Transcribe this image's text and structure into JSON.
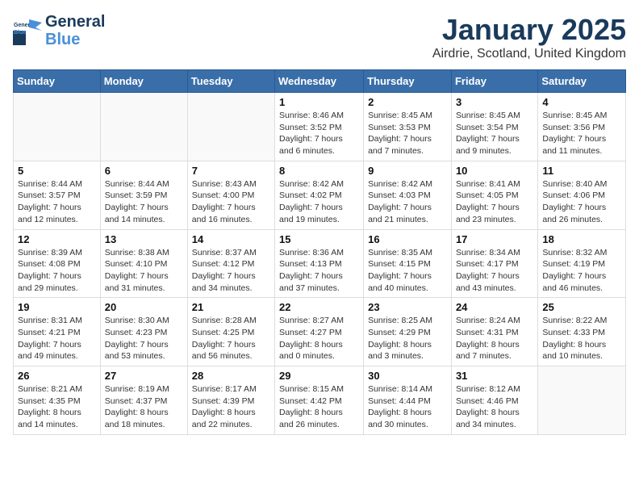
{
  "header": {
    "logo_general": "General",
    "logo_blue": "Blue",
    "month": "January 2025",
    "location": "Airdrie, Scotland, United Kingdom"
  },
  "weekdays": [
    "Sunday",
    "Monday",
    "Tuesday",
    "Wednesday",
    "Thursday",
    "Friday",
    "Saturday"
  ],
  "weeks": [
    [
      {
        "day": "",
        "info": ""
      },
      {
        "day": "",
        "info": ""
      },
      {
        "day": "",
        "info": ""
      },
      {
        "day": "1",
        "info": "Sunrise: 8:46 AM\nSunset: 3:52 PM\nDaylight: 7 hours and 6 minutes."
      },
      {
        "day": "2",
        "info": "Sunrise: 8:45 AM\nSunset: 3:53 PM\nDaylight: 7 hours and 7 minutes."
      },
      {
        "day": "3",
        "info": "Sunrise: 8:45 AM\nSunset: 3:54 PM\nDaylight: 7 hours and 9 minutes."
      },
      {
        "day": "4",
        "info": "Sunrise: 8:45 AM\nSunset: 3:56 PM\nDaylight: 7 hours and 11 minutes."
      }
    ],
    [
      {
        "day": "5",
        "info": "Sunrise: 8:44 AM\nSunset: 3:57 PM\nDaylight: 7 hours and 12 minutes."
      },
      {
        "day": "6",
        "info": "Sunrise: 8:44 AM\nSunset: 3:59 PM\nDaylight: 7 hours and 14 minutes."
      },
      {
        "day": "7",
        "info": "Sunrise: 8:43 AM\nSunset: 4:00 PM\nDaylight: 7 hours and 16 minutes."
      },
      {
        "day": "8",
        "info": "Sunrise: 8:42 AM\nSunset: 4:02 PM\nDaylight: 7 hours and 19 minutes."
      },
      {
        "day": "9",
        "info": "Sunrise: 8:42 AM\nSunset: 4:03 PM\nDaylight: 7 hours and 21 minutes."
      },
      {
        "day": "10",
        "info": "Sunrise: 8:41 AM\nSunset: 4:05 PM\nDaylight: 7 hours and 23 minutes."
      },
      {
        "day": "11",
        "info": "Sunrise: 8:40 AM\nSunset: 4:06 PM\nDaylight: 7 hours and 26 minutes."
      }
    ],
    [
      {
        "day": "12",
        "info": "Sunrise: 8:39 AM\nSunset: 4:08 PM\nDaylight: 7 hours and 29 minutes."
      },
      {
        "day": "13",
        "info": "Sunrise: 8:38 AM\nSunset: 4:10 PM\nDaylight: 7 hours and 31 minutes."
      },
      {
        "day": "14",
        "info": "Sunrise: 8:37 AM\nSunset: 4:12 PM\nDaylight: 7 hours and 34 minutes."
      },
      {
        "day": "15",
        "info": "Sunrise: 8:36 AM\nSunset: 4:13 PM\nDaylight: 7 hours and 37 minutes."
      },
      {
        "day": "16",
        "info": "Sunrise: 8:35 AM\nSunset: 4:15 PM\nDaylight: 7 hours and 40 minutes."
      },
      {
        "day": "17",
        "info": "Sunrise: 8:34 AM\nSunset: 4:17 PM\nDaylight: 7 hours and 43 minutes."
      },
      {
        "day": "18",
        "info": "Sunrise: 8:32 AM\nSunset: 4:19 PM\nDaylight: 7 hours and 46 minutes."
      }
    ],
    [
      {
        "day": "19",
        "info": "Sunrise: 8:31 AM\nSunset: 4:21 PM\nDaylight: 7 hours and 49 minutes."
      },
      {
        "day": "20",
        "info": "Sunrise: 8:30 AM\nSunset: 4:23 PM\nDaylight: 7 hours and 53 minutes."
      },
      {
        "day": "21",
        "info": "Sunrise: 8:28 AM\nSunset: 4:25 PM\nDaylight: 7 hours and 56 minutes."
      },
      {
        "day": "22",
        "info": "Sunrise: 8:27 AM\nSunset: 4:27 PM\nDaylight: 8 hours and 0 minutes."
      },
      {
        "day": "23",
        "info": "Sunrise: 8:25 AM\nSunset: 4:29 PM\nDaylight: 8 hours and 3 minutes."
      },
      {
        "day": "24",
        "info": "Sunrise: 8:24 AM\nSunset: 4:31 PM\nDaylight: 8 hours and 7 minutes."
      },
      {
        "day": "25",
        "info": "Sunrise: 8:22 AM\nSunset: 4:33 PM\nDaylight: 8 hours and 10 minutes."
      }
    ],
    [
      {
        "day": "26",
        "info": "Sunrise: 8:21 AM\nSunset: 4:35 PM\nDaylight: 8 hours and 14 minutes."
      },
      {
        "day": "27",
        "info": "Sunrise: 8:19 AM\nSunset: 4:37 PM\nDaylight: 8 hours and 18 minutes."
      },
      {
        "day": "28",
        "info": "Sunrise: 8:17 AM\nSunset: 4:39 PM\nDaylight: 8 hours and 22 minutes."
      },
      {
        "day": "29",
        "info": "Sunrise: 8:15 AM\nSunset: 4:42 PM\nDaylight: 8 hours and 26 minutes."
      },
      {
        "day": "30",
        "info": "Sunrise: 8:14 AM\nSunset: 4:44 PM\nDaylight: 8 hours and 30 minutes."
      },
      {
        "day": "31",
        "info": "Sunrise: 8:12 AM\nSunset: 4:46 PM\nDaylight: 8 hours and 34 minutes."
      },
      {
        "day": "",
        "info": ""
      }
    ]
  ]
}
